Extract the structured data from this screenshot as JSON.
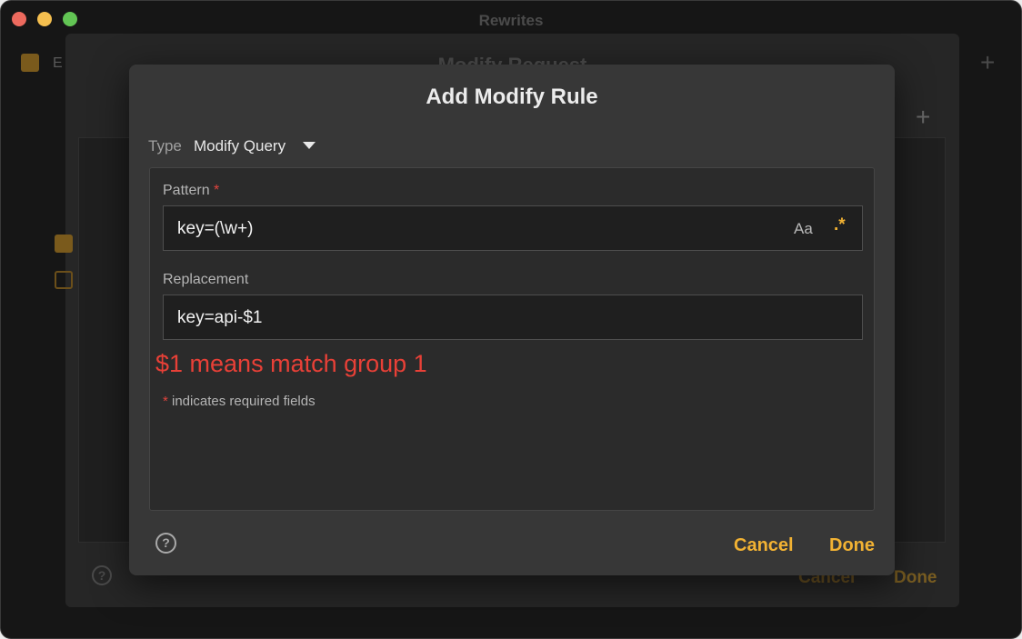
{
  "window": {
    "title": "Rewrites"
  },
  "background": {
    "enable_label": "E",
    "plus_icon": "plus-icon"
  },
  "modify_request_sheet": {
    "title": "Modify Request",
    "cancel_label": "Cancel",
    "done_label": "Done",
    "help_glyph": "?"
  },
  "dialog": {
    "title": "Add Modify Rule",
    "type_label": "Type",
    "type_value": "Modify Query",
    "pattern": {
      "label": "Pattern",
      "required_marker": "*",
      "value": "key=(\\w+)",
      "case_toggle": "Aa",
      "regex_toggle": ".*"
    },
    "replacement": {
      "label": "Replacement",
      "value": "key=api-$1"
    },
    "annotation": "$1 means match group 1",
    "required_note_marker": "*",
    "required_note": " indicates required fields",
    "help_glyph": "?",
    "cancel_label": "Cancel",
    "done_label": "Done"
  },
  "colors": {
    "accent": "#f2b233",
    "required": "#e0443e",
    "annotation": "#e84037"
  }
}
